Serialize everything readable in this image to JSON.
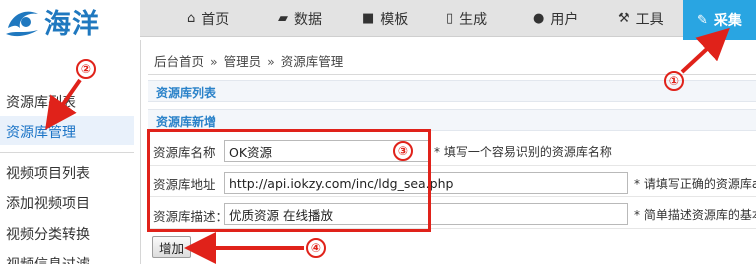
{
  "logo": {
    "text": "海洋"
  },
  "nav": {
    "items": [
      {
        "label": "首页",
        "icon": "home-icon"
      },
      {
        "label": "数据",
        "icon": "database-icon"
      },
      {
        "label": "模板",
        "icon": "template-book-icon"
      },
      {
        "label": "生成",
        "icon": "file-icon"
      },
      {
        "label": "用户",
        "icon": "user-icon"
      },
      {
        "label": "工具",
        "icon": "wrench-icon"
      },
      {
        "label": "采集",
        "icon": "edit-icon",
        "active": true
      }
    ]
  },
  "sidebar": {
    "items": [
      {
        "label": "资源库列表"
      },
      {
        "label": "资源库管理",
        "active": true
      },
      {
        "label": "视频项目列表"
      },
      {
        "label": "添加视频项目"
      },
      {
        "label": "视频分类转换"
      },
      {
        "label": "视频信息过滤"
      }
    ]
  },
  "breadcrumb": [
    "后台首页",
    "管理员",
    "资源库管理"
  ],
  "breadcrumb_sep": "»",
  "sections": {
    "list_title": "资源库列表",
    "add_title": "资源库新增"
  },
  "form": {
    "name": {
      "label": "资源库名称",
      "value": "OK资源",
      "hint": "* 填写一个容易识别的资源库名称"
    },
    "url": {
      "label": "资源库地址",
      "value": "http://api.iokzy.com/inc/ldg_sea.php",
      "hint": "* 请填写正确的资源库a"
    },
    "desc": {
      "label": "资源库描述：",
      "value": "优质资源 在线播放",
      "hint": "* 简单描述资源库的基本"
    }
  },
  "buttons": {
    "add": "增加"
  },
  "annotations": [
    "①",
    "②",
    "③",
    "④"
  ],
  "colors": {
    "accent": "#29a5e2",
    "annotation": "#e0221a",
    "link": "#2a82c9"
  }
}
